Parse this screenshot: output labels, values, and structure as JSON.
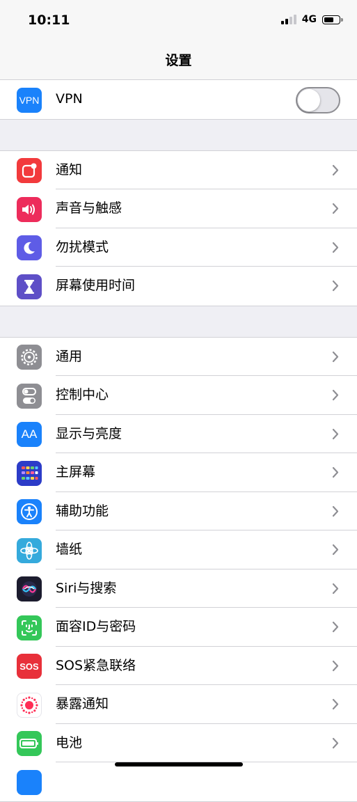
{
  "status_bar": {
    "time": "10:11",
    "network": "4G"
  },
  "nav": {
    "title": "设置"
  },
  "rows": {
    "vpn": {
      "label": "VPN",
      "icon_text": "VPN",
      "icon": "vpn-icon",
      "color": "#1a82fb",
      "toggle_on": false
    },
    "notifications": {
      "label": "通知",
      "icon": "notifications-icon",
      "color": "#f23a3c"
    },
    "sounds": {
      "label": "声音与触感",
      "icon": "speaker-icon",
      "color": "#ed2c5b"
    },
    "do_not_disturb": {
      "label": "勿扰模式",
      "icon": "moon-icon",
      "color": "#5e5ce6"
    },
    "screen_time": {
      "label": "屏幕使用时间",
      "icon": "hourglass-icon",
      "color": "#5e4fc7"
    },
    "general": {
      "label": "通用",
      "icon": "gear-icon",
      "color": "#8e8e93"
    },
    "control_center": {
      "label": "控制中心",
      "icon": "switches-icon",
      "color": "#8e8e93"
    },
    "display": {
      "label": "显示与亮度",
      "icon_text": "AA",
      "icon": "text-size-icon",
      "color": "#1a82fb"
    },
    "home_screen": {
      "label": "主屏幕",
      "icon": "app-grid-icon",
      "color": "#2c3cc8"
    },
    "accessibility": {
      "label": "辅助功能",
      "icon": "accessibility-icon",
      "color": "#1a82fb"
    },
    "wallpaper": {
      "label": "墙纸",
      "icon": "flower-icon",
      "color": "#35aadc"
    },
    "siri": {
      "label": "Siri与搜索",
      "icon": "siri-icon",
      "color": "#1c1c2e"
    },
    "face_id": {
      "label": "面容ID与密码",
      "icon": "face-id-icon",
      "color": "#34c759"
    },
    "sos": {
      "label": "SOS紧急联络",
      "icon_text": "SOS",
      "icon": "sos-icon",
      "color": "#e8303a"
    },
    "exposure": {
      "label": "暴露通知",
      "icon": "exposure-icon",
      "color": "#ffffff"
    },
    "battery": {
      "label": "电池",
      "icon": "battery-icon",
      "color": "#34c759"
    }
  }
}
